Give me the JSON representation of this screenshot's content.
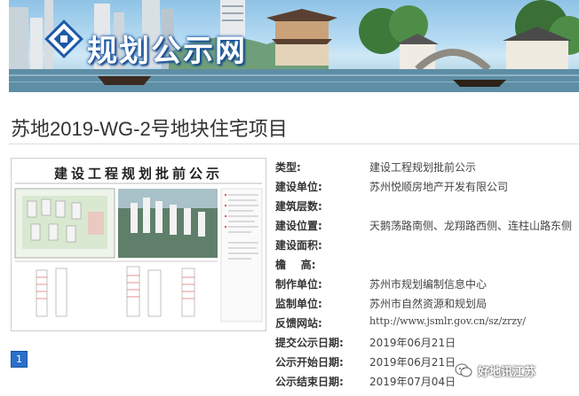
{
  "banner": {
    "title": "规划公示网"
  },
  "project": {
    "title": "苏地2019-WG-2号地块住宅项目"
  },
  "drawing": {
    "heading": "建设工程规划批前公示"
  },
  "pagination": {
    "current": "1"
  },
  "info": [
    {
      "label": "类型:",
      "value": "建设工程规划批前公示"
    },
    {
      "label": "建设单位:",
      "value": "苏州悦顺房地产开发有限公司"
    },
    {
      "label": "建筑层数:",
      "value": ""
    },
    {
      "label": "建设位置:",
      "value": "天鹅荡路南侧、龙翔路西侧、连柱山路东侧"
    },
    {
      "label": "建设面积:",
      "value": ""
    },
    {
      "label": "檐    高:",
      "value": ""
    },
    {
      "label": "制作单位:",
      "value": "苏州市规划编制信息中心"
    },
    {
      "label": "监制单位:",
      "value": "苏州市自然资源和规划局"
    },
    {
      "label": "反馈网站:",
      "value": "http://www.jsmlr.gov.cn/sz/zrzy/"
    },
    {
      "label": "提交公示日期:",
      "value": "2019年06月21日"
    },
    {
      "label": "公示开始日期:",
      "value": "2019年06月21日"
    },
    {
      "label": "公示结束日期:",
      "value": "2019年07月04日"
    }
  ],
  "watermark": {
    "text": "好地讯江苏"
  },
  "colors": {
    "accent": "#2a6fc9",
    "banner_sky": "#8fc3e6"
  }
}
